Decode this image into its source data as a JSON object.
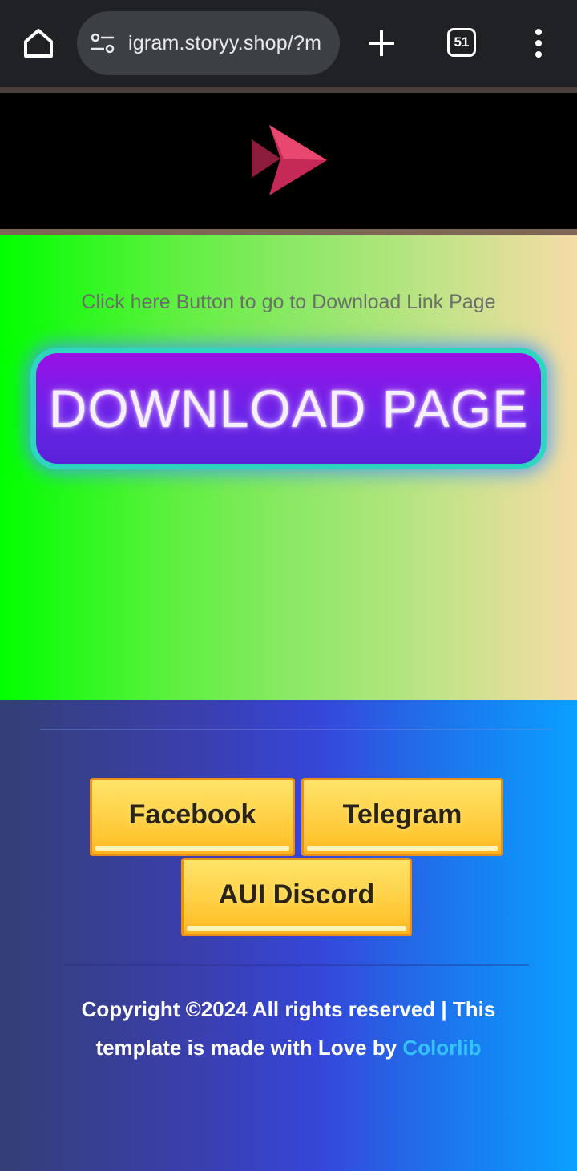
{
  "browser": {
    "url": "igram.storyy.shop/?m",
    "tab_count": "51",
    "icons": [
      "home-icon",
      "site-info-icon",
      "plus-icon",
      "tab-switcher-icon",
      "more-vert-icon"
    ]
  },
  "header": {
    "logo_icon": "play-arrow-logo-icon",
    "logo_colors": [
      "#e8476f",
      "#c42a55",
      "#8e1d3c"
    ]
  },
  "hero": {
    "caption": "Click here Button to go to Download Link Page",
    "download_button_label": "DOWNLOAD PAGE"
  },
  "footer": {
    "buttons": [
      {
        "label": "Facebook"
      },
      {
        "label": "Telegram"
      },
      {
        "label": "AUI Discord"
      }
    ],
    "copyright_text": "Copyright ©2024 All rights reserved | This template is made with Love by",
    "credit_link": "Colorlib"
  },
  "colors": {
    "download_button_border": "#2ed6c0",
    "download_button_fill": "#7a1ae6",
    "social_button_fill": "#ffd54a",
    "link_color": "#35c3ff"
  }
}
